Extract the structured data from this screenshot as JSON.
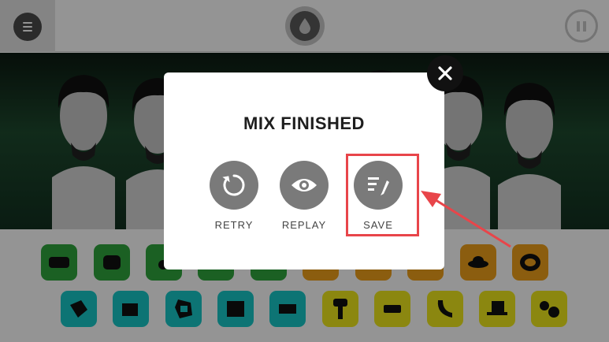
{
  "app": {
    "menu_icon": "hamburger-icon",
    "logo_icon": "drop-logo-icon",
    "pause_icon": "pause-icon"
  },
  "modal": {
    "title": "MIX FINISHED",
    "close_icon": "close-icon",
    "actions": [
      {
        "label": "RETRY",
        "icon": "retry-icon"
      },
      {
        "label": "REPLAY",
        "icon": "eye-icon"
      },
      {
        "label": "SAVE",
        "icon": "save-pen-icon"
      }
    ]
  },
  "annotation": {
    "highlight_color": "#e8454a",
    "target": "SAVE"
  },
  "colors": {
    "tile_green": "#2fa63d",
    "tile_orange": "#f0a01a",
    "tile_cyan": "#17c8c9",
    "tile_yellow": "#f0e81c",
    "modal_button": "#7a7a7a"
  }
}
